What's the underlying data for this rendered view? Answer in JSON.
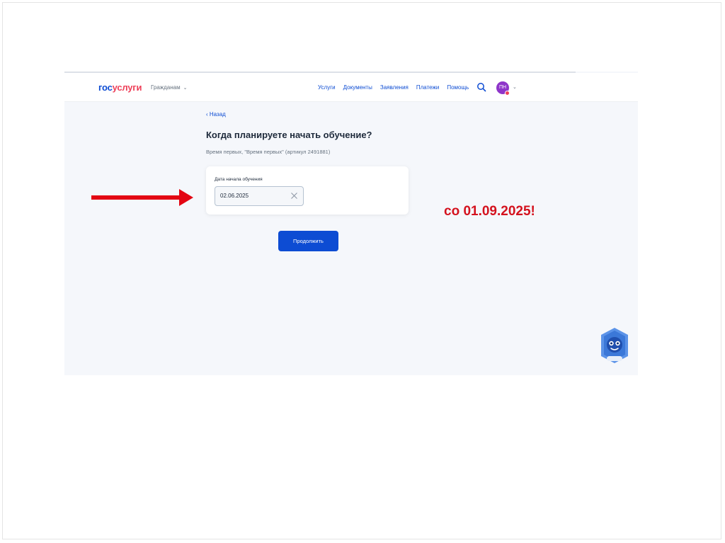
{
  "header": {
    "logo_gos": "гос",
    "logo_uslugi": "услуги",
    "audience_label": "Гражданам",
    "nav": [
      "Услуги",
      "Документы",
      "Заявления",
      "Платежи",
      "Помощь"
    ],
    "avatar_initials": "ПН"
  },
  "page": {
    "back_label": "Назад",
    "title": "Когда планируете начать обучение?",
    "subtitle": "Время первых, \"Время первых\" (артикул 2491881)"
  },
  "form": {
    "field_label": "Дата начала обучения",
    "date_value": "02.06.2025",
    "continue_label": "Продолжить"
  },
  "annotation": {
    "text": "со 01.09.2025!",
    "color": "#d4121e"
  },
  "colors": {
    "brand_blue": "#0d4cd3",
    "brand_red": "#ee3f58",
    "avatar": "#8e35c9"
  },
  "icons": [
    "chevron-down-icon",
    "search-icon",
    "close-icon",
    "chevron-left-icon",
    "assistant-robot-icon",
    "red-arrow-icon"
  ]
}
